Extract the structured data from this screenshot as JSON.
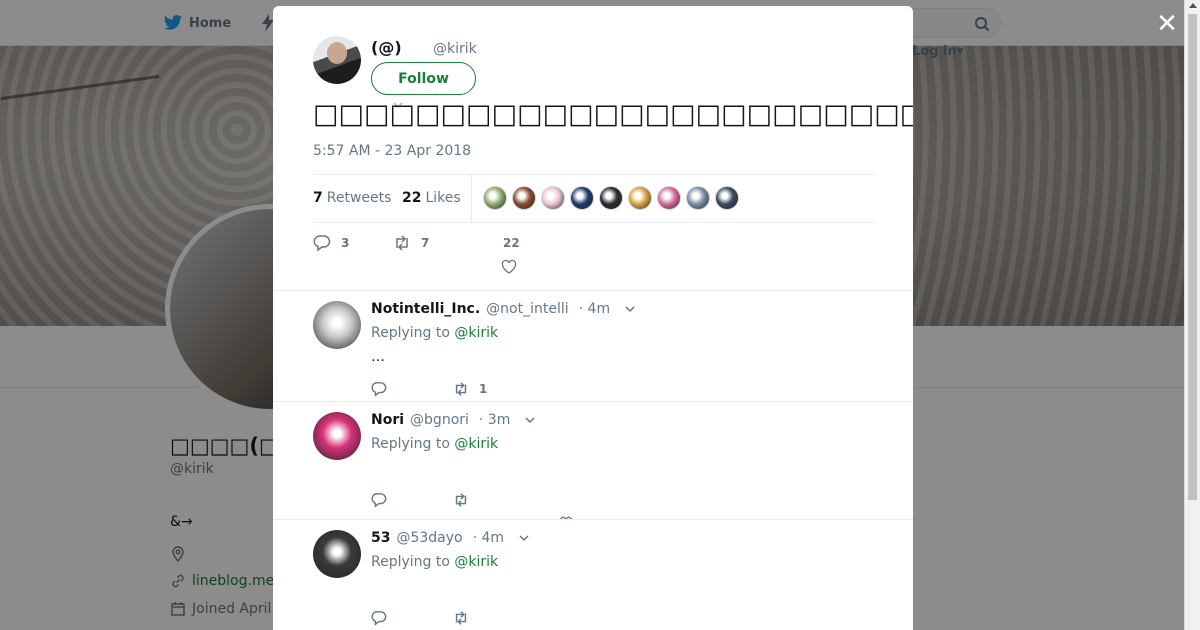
{
  "nav": {
    "home_label": "Home",
    "login_label": "Log in"
  },
  "profile": {
    "name": "□□□□(□□□□",
    "handle": "@kirik",
    "bio": "&→",
    "website": "lineblog.me",
    "joined": "Joined April"
  },
  "modal": {
    "author_name": "(@)",
    "author_handle": "@kirik",
    "follow_label": "Follow",
    "tweet_text": "□□□□□□□□□□□□□□□□□□□□□□□□□□□□□□□□□□□□□□□□□□□□□…□",
    "timestamp": "5:57 AM - 23 Apr 2018",
    "retweets_count": "7",
    "retweets_label": "Retweets",
    "likes_count": "22",
    "likes_label": "Likes",
    "liker_colors": [
      "#8fae6a",
      "#8a4b2c",
      "#e9c7cf",
      "#1f3b6e",
      "#2b2b2b",
      "#d9a441",
      "#d96aa0",
      "#7a8fa8",
      "#3a4a5c"
    ],
    "actions": {
      "reply_count": "3",
      "retweet_count": "7",
      "like_count": "22"
    }
  },
  "replies": [
    {
      "name": "Notintelli_Inc.",
      "handle": "@not_intelli",
      "time": "· 4m",
      "replying_prefix": "Replying to",
      "replying_to": "@kirik",
      "body": "…",
      "retweet_count": "1",
      "avatar_color": "#c9c9c9"
    },
    {
      "name": "Nori",
      "handle": "@bgnori",
      "time": "· 3m",
      "replying_prefix": "Replying to",
      "replying_to": "@kirik",
      "body": "",
      "retweet_count": "",
      "avatar_color": "#d8327a"
    },
    {
      "name": "53",
      "handle": "@53dayo",
      "time": "· 4m",
      "replying_prefix": "Replying to",
      "replying_to": "@kirik",
      "body": "",
      "retweet_count": "",
      "avatar_color": "#3a3a3a"
    }
  ]
}
